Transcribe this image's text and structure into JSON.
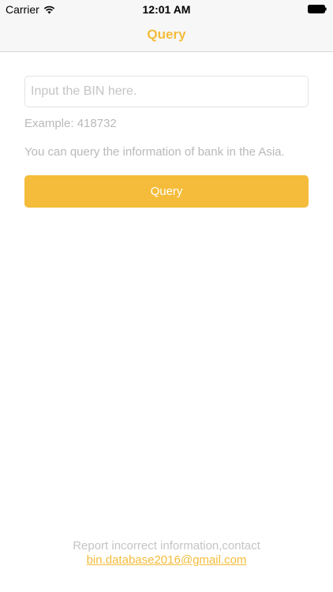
{
  "status_bar": {
    "carrier": "Carrier",
    "time": "12:01 AM",
    "icons": [
      "wifi-icon",
      "battery-icon"
    ]
  },
  "nav": {
    "title": "Query"
  },
  "form": {
    "input_value": "",
    "input_placeholder": "Input the BIN here.",
    "example": "Example: 418732",
    "info": "You can query the information of bank in the Asia.",
    "button_label": "Query"
  },
  "footer": {
    "text": "Report incorrect information,contact",
    "email": "bin.database2016@gmail.com"
  },
  "colors": {
    "accent": "#f4bc3a",
    "muted_text": "#b9b9b9",
    "bar_background": "#f7f7f7"
  }
}
